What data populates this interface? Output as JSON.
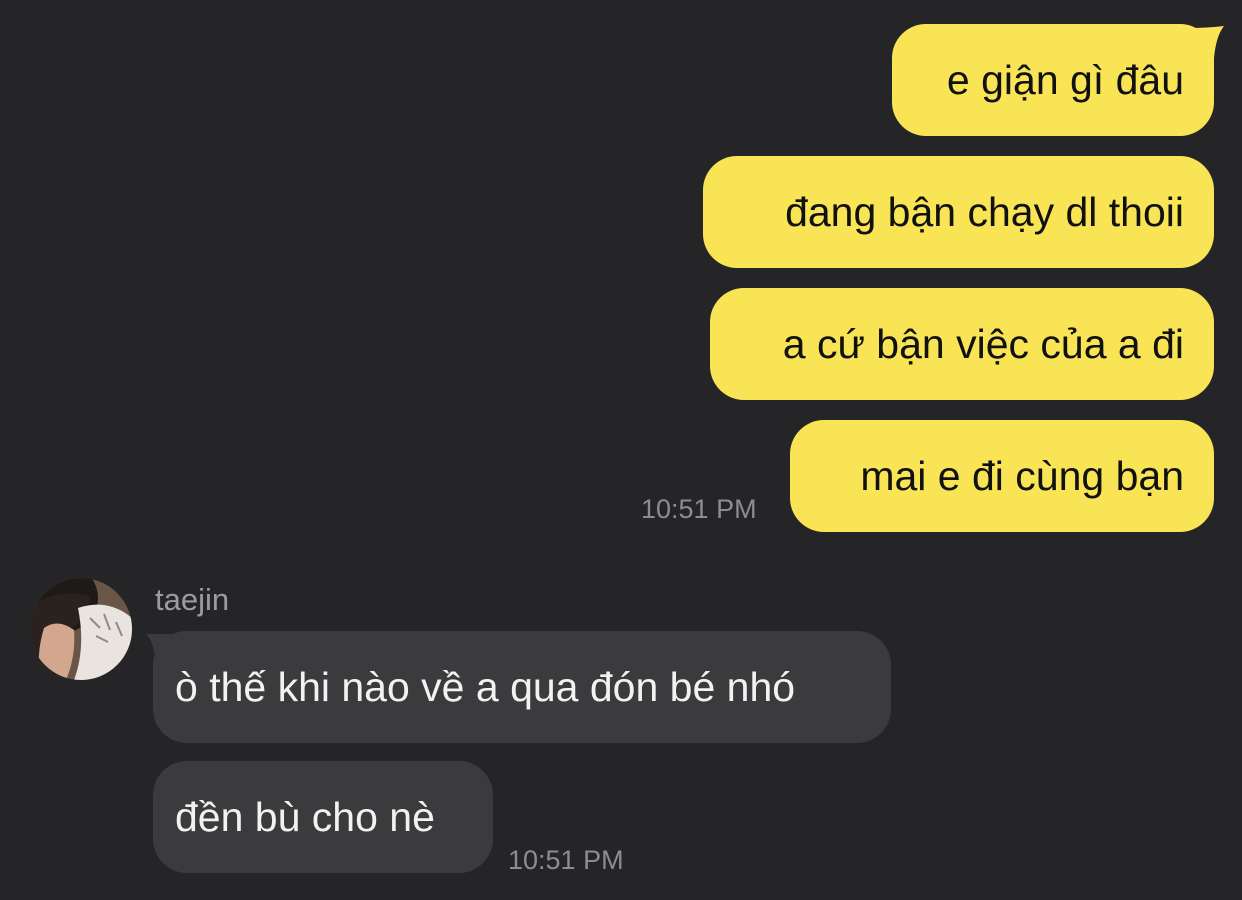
{
  "conversation": {
    "sent_messages": [
      {
        "text": "e giận gì đâu"
      },
      {
        "text": "đang bận chạy dl thoii"
      },
      {
        "text": "a cứ bận việc của a đi"
      },
      {
        "text": "mai e đi cùng bạn"
      }
    ],
    "sent_time": "10:51 PM",
    "received": {
      "sender": "taejin",
      "messages": [
        {
          "text": "ò thế khi nào về a qua đón bé nhó"
        },
        {
          "text": "đền bù cho nè"
        }
      ],
      "time": "10:51 PM"
    }
  },
  "colors": {
    "background": "#252527",
    "sent_bubble": "#f8e454",
    "received_bubble": "#3b3b3d",
    "timestamp": "#8d8d8f"
  },
  "icons": {
    "avatar": "profile-photo"
  }
}
